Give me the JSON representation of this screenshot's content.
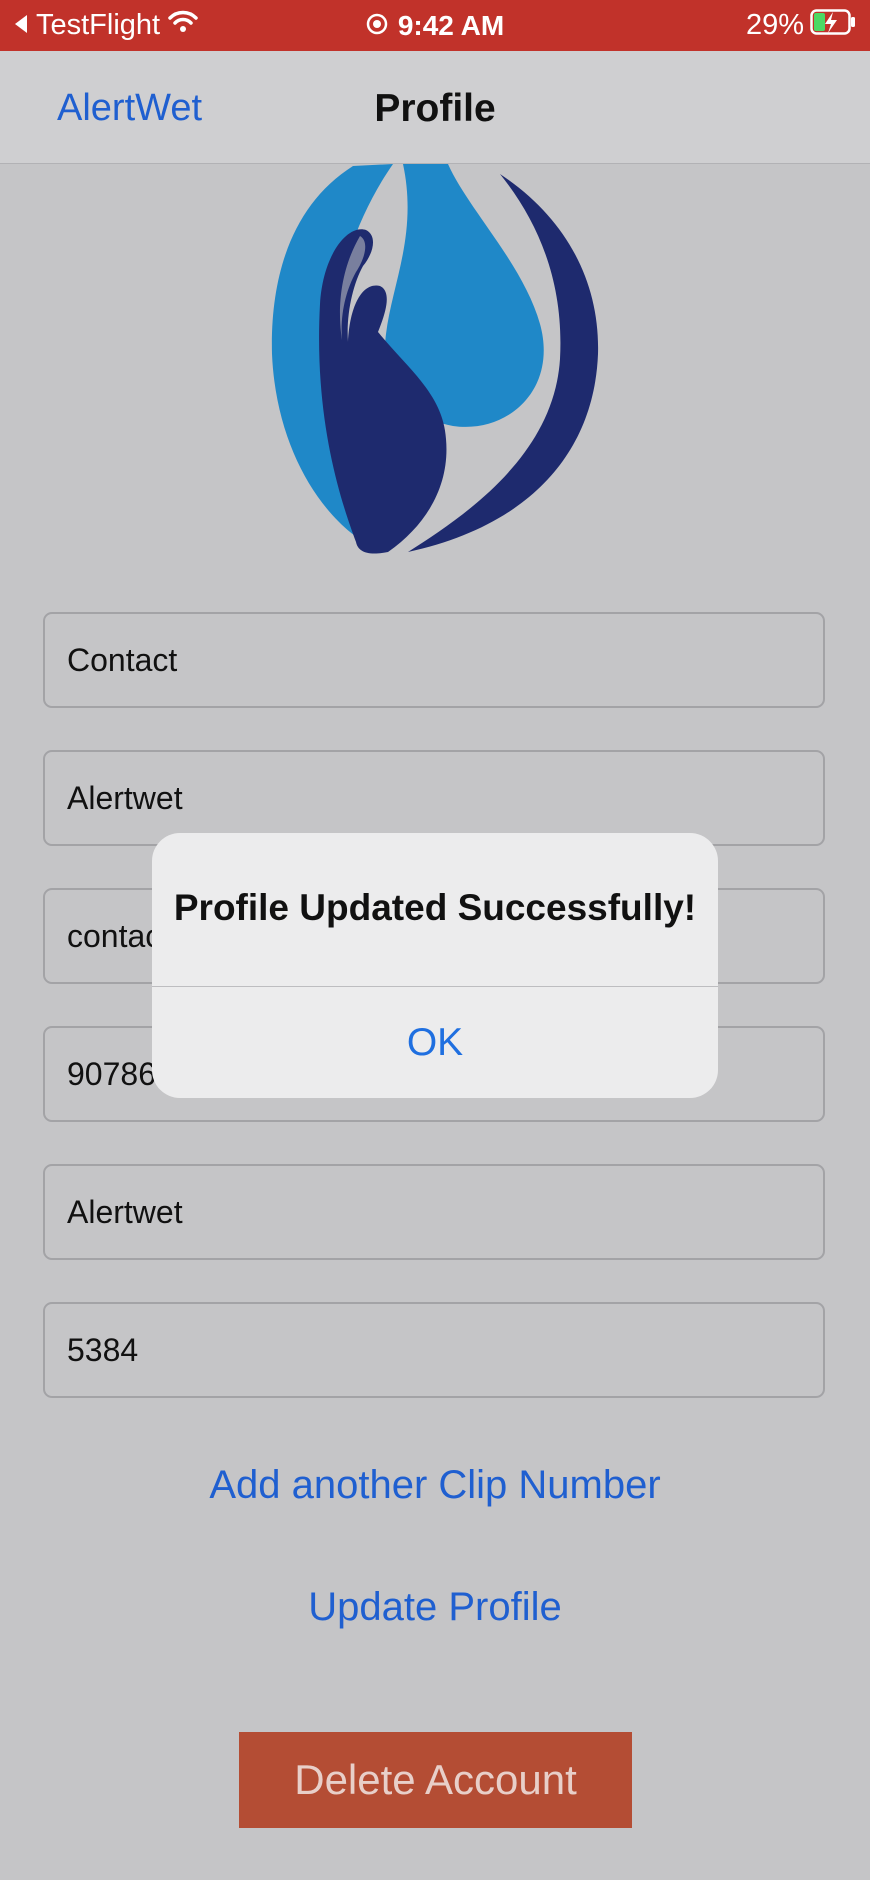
{
  "status_bar": {
    "back_app": "TestFlight",
    "time": "9:42 AM",
    "battery": "29%",
    "background_color": "#c1322a"
  },
  "nav": {
    "back_label": "AlertWet",
    "title": "Profile"
  },
  "logo": {
    "icon": "water-drop-hand-logo-icon"
  },
  "fields": [
    "Contact",
    "Alertwet",
    "contac",
    "90786",
    "Alertwet",
    "5384"
  ],
  "actions": {
    "add_clip": "Add another Clip Number",
    "update_profile": "Update Profile",
    "delete_account": "Delete Account"
  },
  "alert": {
    "title": "Profile Updated Successfully!",
    "ok": "OK"
  },
  "colors": {
    "link": "#1f5fd0",
    "delete": "#b44d34",
    "logo_light": "#1f88c8",
    "logo_dark": "#1e2a6e"
  }
}
